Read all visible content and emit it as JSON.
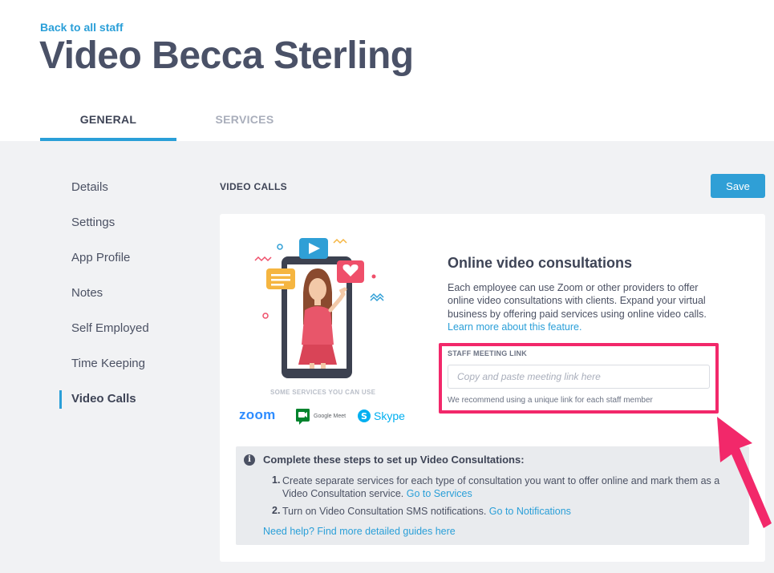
{
  "header": {
    "back_link": "Back to all staff",
    "title": "Video Becca Sterling",
    "tabs": [
      {
        "label": "GENERAL",
        "active": true
      },
      {
        "label": "SERVICES",
        "active": false
      }
    ]
  },
  "sidebar": {
    "items": [
      {
        "label": "Details"
      },
      {
        "label": "Settings"
      },
      {
        "label": "App Profile"
      },
      {
        "label": "Notes"
      },
      {
        "label": "Self Employed"
      },
      {
        "label": "Time Keeping"
      },
      {
        "label": "Video Calls",
        "active": true
      }
    ]
  },
  "main": {
    "section_title": "VIDEO CALLS",
    "save_label": "Save",
    "card": {
      "services_caption": "SOME SERVICES YOU CAN USE",
      "logos": {
        "zoom": "zoom",
        "google_meet": "Google Meet",
        "skype": "Skype"
      },
      "title": "Online video consultations",
      "description": "Each employee can use Zoom or other providers to offer online video consultations with clients. Expand your virtual business by offering paid services using online video calls.",
      "learn_more": "Learn more about this feature.",
      "field": {
        "label": "STAFF MEETING LINK",
        "placeholder": "Copy and paste meeting link here",
        "value": "",
        "hint": "We recommend using a unique link for each staff member"
      },
      "steps": {
        "title": "Complete these steps to set up Video Consultations:",
        "items": [
          {
            "num": "1.",
            "text": "Create separate services for each type of consultation you want to offer online and mark them as a Video Consultation service.",
            "link": "Go to Services"
          },
          {
            "num": "2.",
            "text": "Turn on Video Consultation SMS notifications.",
            "link": "Go to Notifications"
          }
        ],
        "help": "Need help? Find more detailed guides here"
      }
    }
  },
  "colors": {
    "accent": "#2a9fd8",
    "highlight": "#f2286a",
    "title": "#4a5167"
  }
}
